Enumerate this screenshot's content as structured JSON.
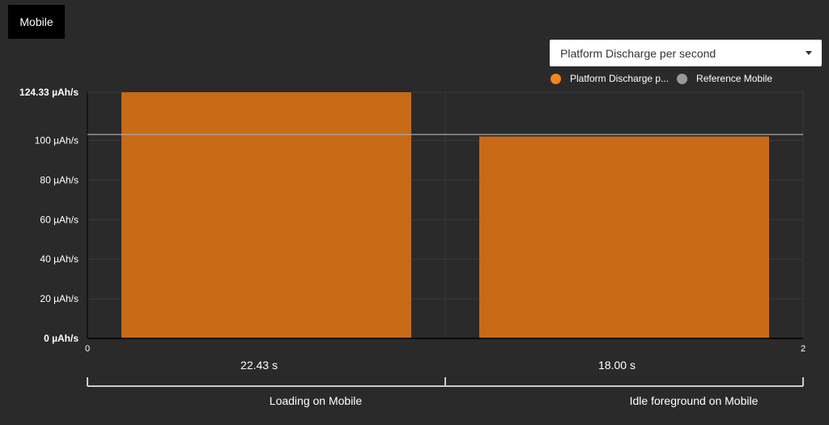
{
  "tab": {
    "label": "Mobile"
  },
  "metric_select": {
    "value": "Platform Discharge per second"
  },
  "legend": [
    {
      "label": "Platform Discharge p...",
      "color": "#f2861e"
    },
    {
      "label": "Reference Mobile",
      "color": "#9a9a9a"
    }
  ],
  "colors": {
    "bar": "#c86a17",
    "reference": "#aaaaaa",
    "background": "#2a2a2a"
  },
  "chart_data": {
    "type": "bar",
    "ylim": [
      0,
      124.33
    ],
    "xlim": [
      0,
      2
    ],
    "y_ticks": [
      "0 µAh/s",
      "20 µAh/s",
      "40 µAh/s",
      "60 µAh/s",
      "80 µAh/s",
      "100 µAh/s",
      "124.33 µAh/s"
    ],
    "y_tick_values": [
      0,
      20,
      40,
      60,
      80,
      100,
      124.33
    ],
    "x_ticks": [
      "0",
      "2"
    ],
    "x_tick_values": [
      0,
      2
    ],
    "categories": [
      "Loading on Mobile",
      "Idle foreground on Mobile"
    ],
    "durations": [
      "22.43 s",
      "18.00 s"
    ],
    "series": [
      {
        "name": "Platform Discharge p...",
        "values": [
          124.33,
          102
        ]
      }
    ],
    "reference": {
      "name": "Reference Mobile",
      "value": 103
    },
    "grid": true,
    "legend_position": "top-right"
  }
}
